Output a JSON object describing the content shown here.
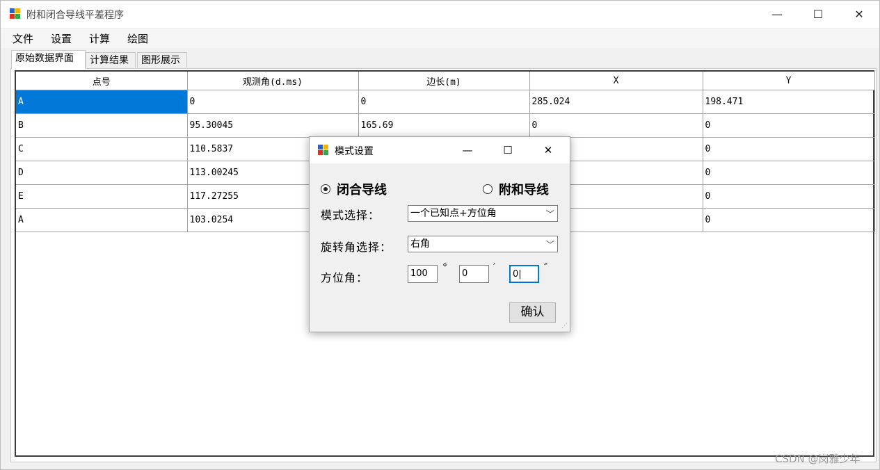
{
  "window": {
    "title": "附和闭合导线平差程序",
    "minimize_glyph": "—",
    "maximize_glyph": "☐",
    "close_glyph": "✕"
  },
  "menu": [
    "文件",
    "设置",
    "计算",
    "绘图"
  ],
  "tabs": [
    "原始数据界面",
    "计算结果",
    "图形展示"
  ],
  "grid": {
    "columns": [
      "点号",
      "观测角(d.ms)",
      "边长(m)",
      "X",
      "Y"
    ],
    "rows": [
      [
        "A",
        "0",
        "0",
        "285.024",
        "198.471"
      ],
      [
        "B",
        "95.30045",
        "165.69",
        "0",
        "0"
      ],
      [
        "C",
        "110.5837",
        "",
        "",
        "0"
      ],
      [
        "D",
        "113.00245",
        "",
        "",
        "0"
      ],
      [
        "E",
        "117.27255",
        "",
        "",
        "0"
      ],
      [
        "A",
        "103.0254",
        "",
        "",
        "0"
      ]
    ]
  },
  "dialog": {
    "title": "模式设置",
    "radio_closed": "闭合导线",
    "radio_attached": "附和导线",
    "mode_label": "模式选择：",
    "mode_value": "一个已知点+方位角",
    "rotation_label": "旋转角选择：",
    "rotation_value": "右角",
    "azimuth_label": "方位角：",
    "deg_value": "100",
    "min_value": "0",
    "sec_value": "0|",
    "deg_unit": "°",
    "min_unit": "′",
    "sec_unit": "″",
    "ok_label": "确认"
  },
  "watermark": "CSDN @岗雅少年",
  "colors": {
    "selection": "#0078d7"
  }
}
